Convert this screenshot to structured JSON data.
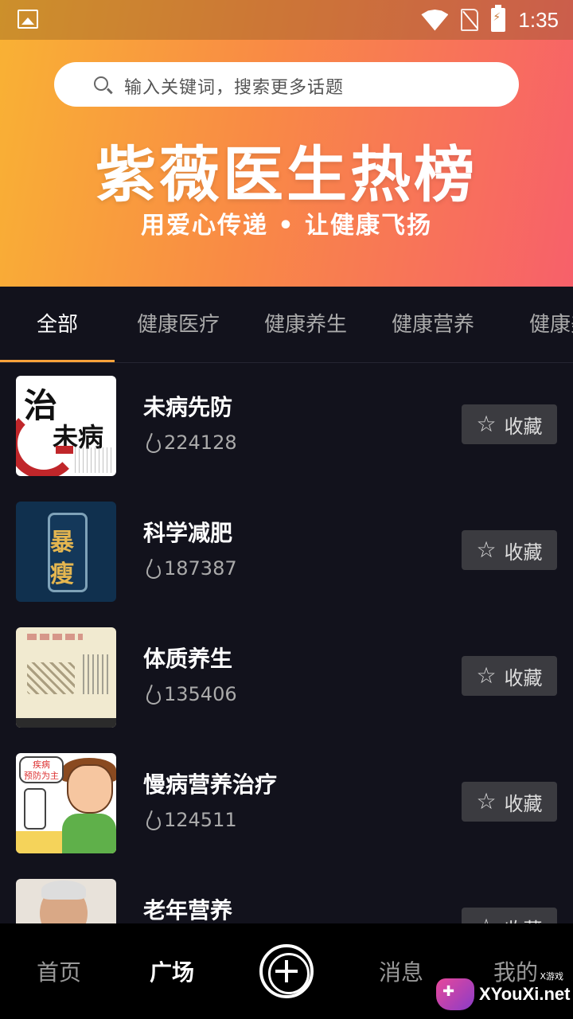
{
  "status": {
    "time": "1:35"
  },
  "search": {
    "placeholder": "输入关键词，搜索更多话题"
  },
  "hero": {
    "title": "紫薇医生热榜",
    "subtitle": "用爱心传递 • 让健康飞扬"
  },
  "tabs": [
    {
      "label": "全部",
      "active": true
    },
    {
      "label": "健康医疗",
      "active": false
    },
    {
      "label": "健康养生",
      "active": false
    },
    {
      "label": "健康营养",
      "active": false
    },
    {
      "label": "健康美",
      "active": false
    }
  ],
  "list": [
    {
      "title": "未病先防",
      "count": "224128",
      "fav_label": "收藏",
      "thumb_text": [
        "治",
        "未病"
      ]
    },
    {
      "title": "科学减肥",
      "count": "187387",
      "fav_label": "收藏",
      "thumb_text": [
        "暴",
        "瘦"
      ]
    },
    {
      "title": "体质养生",
      "count": "135406",
      "fav_label": "收藏"
    },
    {
      "title": "慢病营养治疗",
      "count": "124511",
      "fav_label": "收藏",
      "thumb_text": [
        "疾病\n预防为主"
      ]
    },
    {
      "title": "老年营养",
      "count": "",
      "fav_label": "收藏"
    }
  ],
  "bottom_nav": {
    "home": "首页",
    "plaza": "广场",
    "messages": "消息",
    "mine": "我的"
  },
  "watermark": {
    "text": "XYouXi.net",
    "sub": "X游戏"
  },
  "colors": {
    "accent": "#f7a23a",
    "background": "#12121c",
    "gradient_start": "#f9b234",
    "gradient_end": "#f7606a"
  }
}
